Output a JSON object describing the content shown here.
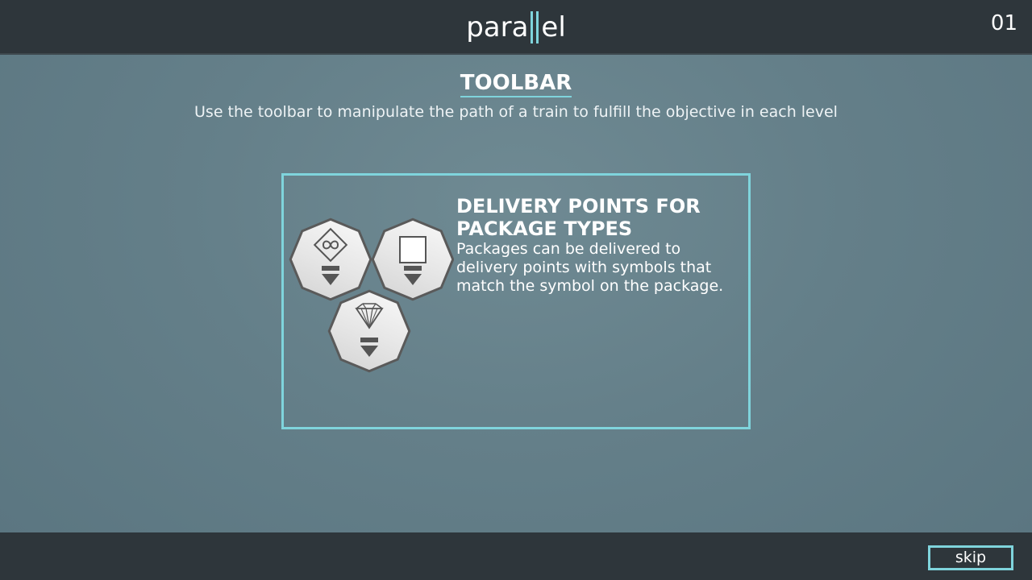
{
  "header": {
    "logo_left": "para",
    "logo_right": "el",
    "level_number": "01"
  },
  "intro": {
    "title": "TOOLBAR",
    "subtitle": "Use the toolbar to manipulate the path of a train to fulfill the objective in each level"
  },
  "panel": {
    "heading": "DELIVERY POINTS FOR PACKAGE TYPES",
    "body": "Packages can be delivered to delivery points with symbols that match the symbol on the package.",
    "icons": [
      "infinity-diamond-icon",
      "square-icon",
      "gem-icon"
    ]
  },
  "footer": {
    "skip_label": "skip"
  },
  "colors": {
    "accent": "#7fd4dc",
    "bar": "#2e363b",
    "background": "#647f89"
  }
}
